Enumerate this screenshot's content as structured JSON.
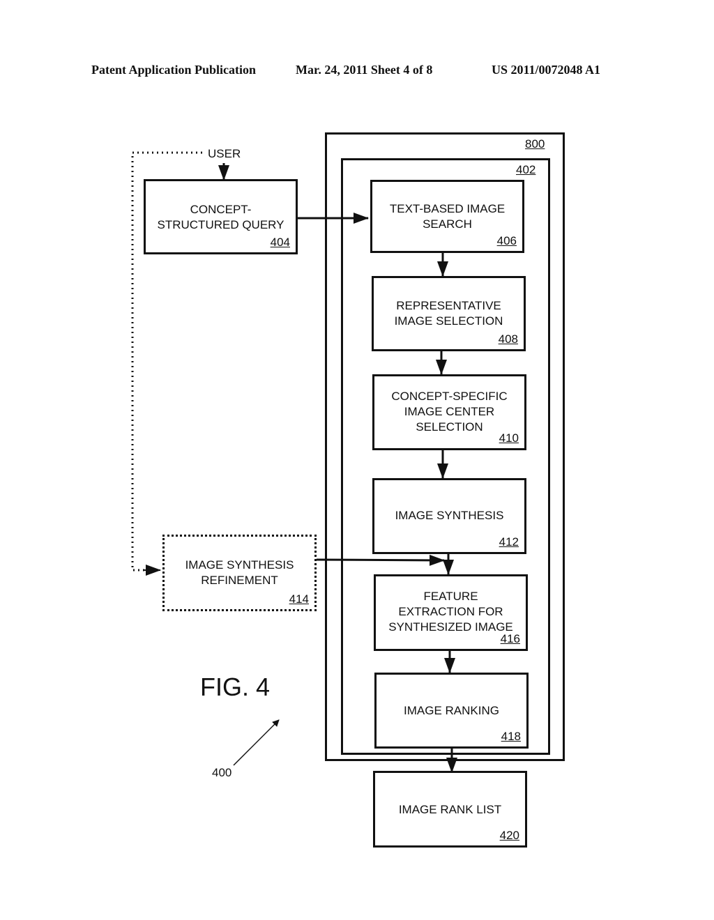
{
  "header": {
    "publication": "Patent Application Publication",
    "date_sheet": "Mar. 24, 2011  Sheet 4 of 8",
    "pub_number": "US 2011/0072048 A1"
  },
  "figure": {
    "title": "FIG. 4",
    "ref": "400",
    "user_label": "USER",
    "outer_frame_ref": "800",
    "inner_frame_ref": "402",
    "boxes": {
      "query": {
        "text": "CONCEPT-\nSTRUCTURED QUERY",
        "ref": "404"
      },
      "text_search": {
        "text": "TEXT-BASED IMAGE\nSEARCH",
        "ref": "406"
      },
      "representative": {
        "text": "REPRESENTATIVE\nIMAGE SELECTION",
        "ref": "408"
      },
      "center_selection": {
        "text": "CONCEPT-SPECIFIC\nIMAGE CENTER\nSELECTION",
        "ref": "410"
      },
      "synthesis": {
        "text": "IMAGE SYNTHESIS",
        "ref": "412"
      },
      "refinement": {
        "text": "IMAGE SYNTHESIS\nREFINEMENT",
        "ref": "414"
      },
      "feature_extraction": {
        "text": "FEATURE\nEXTRACTION FOR\nSYNTHESIZED IMAGE",
        "ref": "416"
      },
      "ranking": {
        "text": "IMAGE RANKING",
        "ref": "418"
      },
      "rank_list": {
        "text": "IMAGE RANK LIST",
        "ref": "420"
      }
    }
  }
}
